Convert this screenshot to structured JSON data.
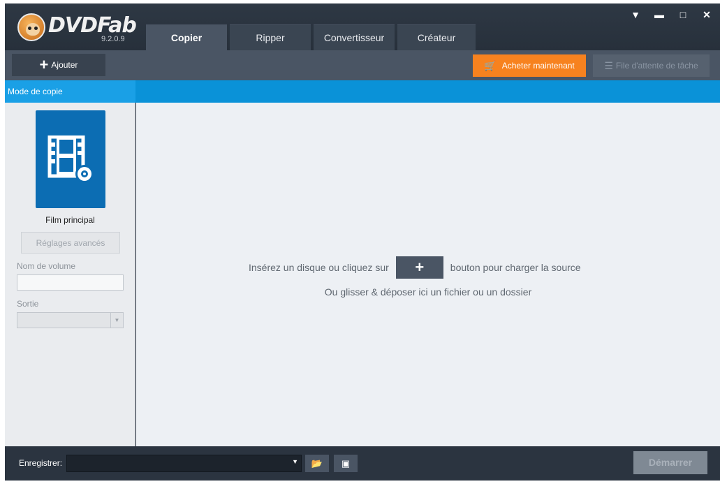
{
  "app": {
    "name": "DVDFab",
    "version": "9.2.0.9"
  },
  "tabs": [
    {
      "label": "Copier",
      "active": true
    },
    {
      "label": "Ripper",
      "active": false
    },
    {
      "label": "Convertisseur",
      "active": false
    },
    {
      "label": "Créateur",
      "active": false
    }
  ],
  "window_controls": {
    "menu_icon": "chevron-down-icon",
    "minimize_icon": "minimize-icon",
    "maximize_icon": "maximize-icon",
    "close_icon": "close-icon"
  },
  "toolbar": {
    "add_label": "Ajouter",
    "buy_label": "Acheter maintenant",
    "queue_label": "File d'attente de tâche"
  },
  "mode": {
    "title": "Mode de copie"
  },
  "sidebar": {
    "mode_tile_label": "Film principal",
    "advanced_button": "Réglages avancés",
    "volume_label": "Nom de volume",
    "volume_value": "",
    "output_label": "Sortie",
    "output_value": ""
  },
  "main": {
    "hint_before": "Insérez un disque ou cliquez sur",
    "hint_after": "bouton pour charger la source",
    "hint_drag": "Ou glisser & déposer ici un fichier ou un dossier"
  },
  "bottom": {
    "save_label": "Enregistrer:",
    "save_path": "",
    "start_label": "Démarrer"
  },
  "colors": {
    "accent_blue": "#0a92d8",
    "tile_blue": "#0c6db3",
    "buy_orange": "#f7821f",
    "dark_bg": "#2b3440"
  }
}
